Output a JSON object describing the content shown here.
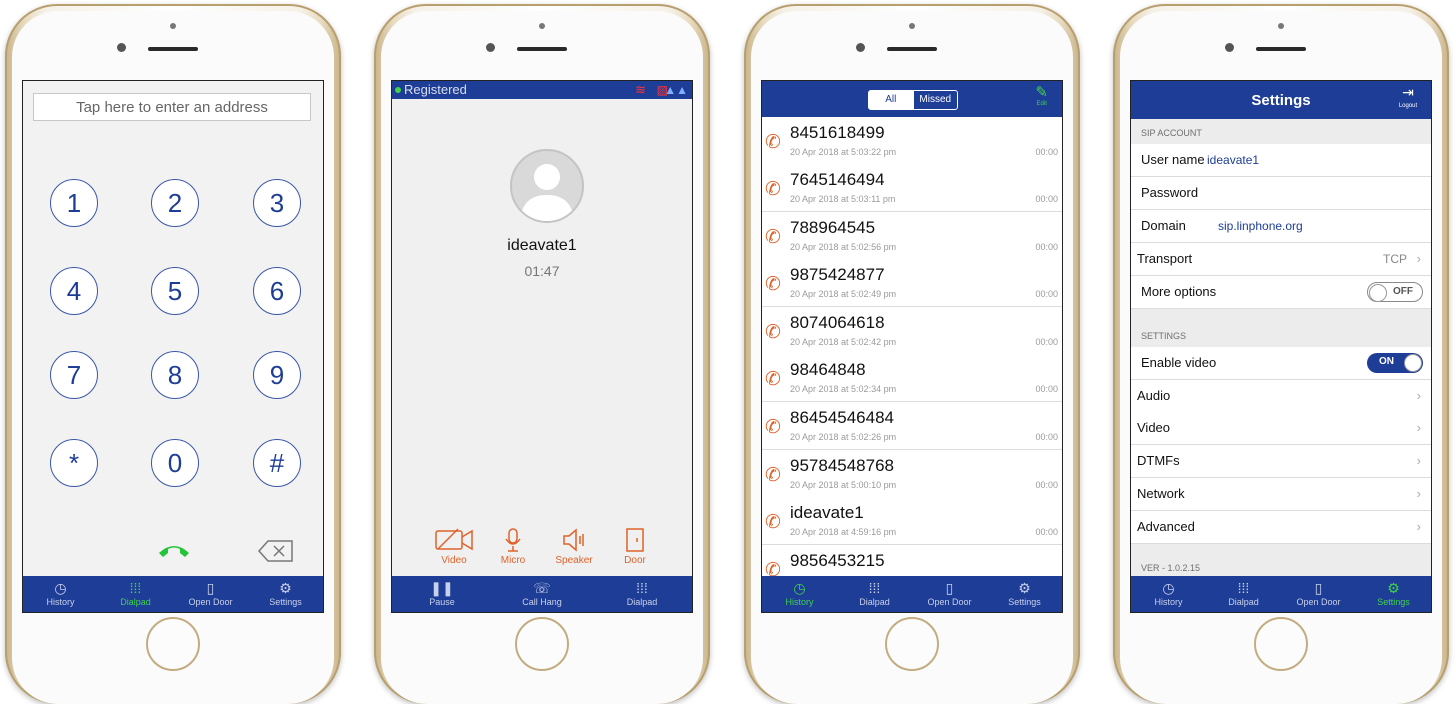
{
  "tabs_main": [
    {
      "label": "History",
      "icon": "history-icon"
    },
    {
      "label": "Dialpad",
      "icon": "dialpad-icon"
    },
    {
      "label": "Open Door",
      "icon": "door-icon"
    },
    {
      "label": "Settings",
      "icon": "gear-icon"
    }
  ],
  "dialpad": {
    "address_placeholder": "Tap here to enter an address",
    "keys": [
      "1",
      "2",
      "3",
      "4",
      "5",
      "6",
      "7",
      "8",
      "9",
      "*",
      "0",
      "#"
    ]
  },
  "incall": {
    "status": "Registered",
    "caller": "ideavate1",
    "duration": "01:47",
    "actions": [
      "Video",
      "Micro",
      "Speaker",
      "Door"
    ],
    "tabs": [
      "Pause",
      "Call Hang",
      "Dialpad"
    ]
  },
  "history": {
    "filter_all": "All",
    "filter_missed": "Missed",
    "edit_label": "Edit",
    "rows": [
      {
        "number": "8451618499",
        "date": "20 Apr 2018 at 5:03:22 pm",
        "duration": "00:00"
      },
      {
        "number": "7645146494",
        "date": "20 Apr 2018 at 5:03:11 pm",
        "duration": "00:00"
      },
      {
        "number": "788964545",
        "date": "20 Apr 2018 at 5:02:56 pm",
        "duration": "00:00"
      },
      {
        "number": "9875424877",
        "date": "20 Apr 2018 at 5:02:49 pm",
        "duration": "00:00"
      },
      {
        "number": "8074064618",
        "date": "20 Apr 2018 at 5:02:42 pm",
        "duration": "00:00"
      },
      {
        "number": "98464848",
        "date": "20 Apr 2018 at 5:02:34 pm",
        "duration": "00:00"
      },
      {
        "number": "86454546484",
        "date": "20 Apr 2018 at 5:02:26 pm",
        "duration": "00:00"
      },
      {
        "number": "95784548768",
        "date": "20 Apr 2018 at 5:00:10 pm",
        "duration": "00:00"
      },
      {
        "number": "ideavate1",
        "date": "20 Apr 2018 at 4:59:16 pm",
        "duration": "00:00"
      },
      {
        "number": "9856453215",
        "date": "",
        "duration": ""
      }
    ]
  },
  "settings": {
    "title": "Settings",
    "logout_label": "Logout",
    "sip_section": "SIP ACCOUNT",
    "username_label": "User name",
    "username_value": "ideavate1",
    "password_label": "Password",
    "domain_label": "Domain",
    "domain_value": "sip.linphone.org",
    "transport_label": "Transport",
    "transport_value": "TCP",
    "more_options_label": "More options",
    "more_options_state": "OFF",
    "settings_section": "SETTINGS",
    "enable_video_label": "Enable video",
    "enable_video_state": "ON",
    "items": [
      "Audio",
      "Video",
      "DTMFs",
      "Network",
      "Advanced"
    ],
    "version": "VER - 1.0.2.15"
  },
  "colors": {
    "accent": "#1e3d96",
    "active": "#3fd24a",
    "call_action": "#e0622a"
  }
}
